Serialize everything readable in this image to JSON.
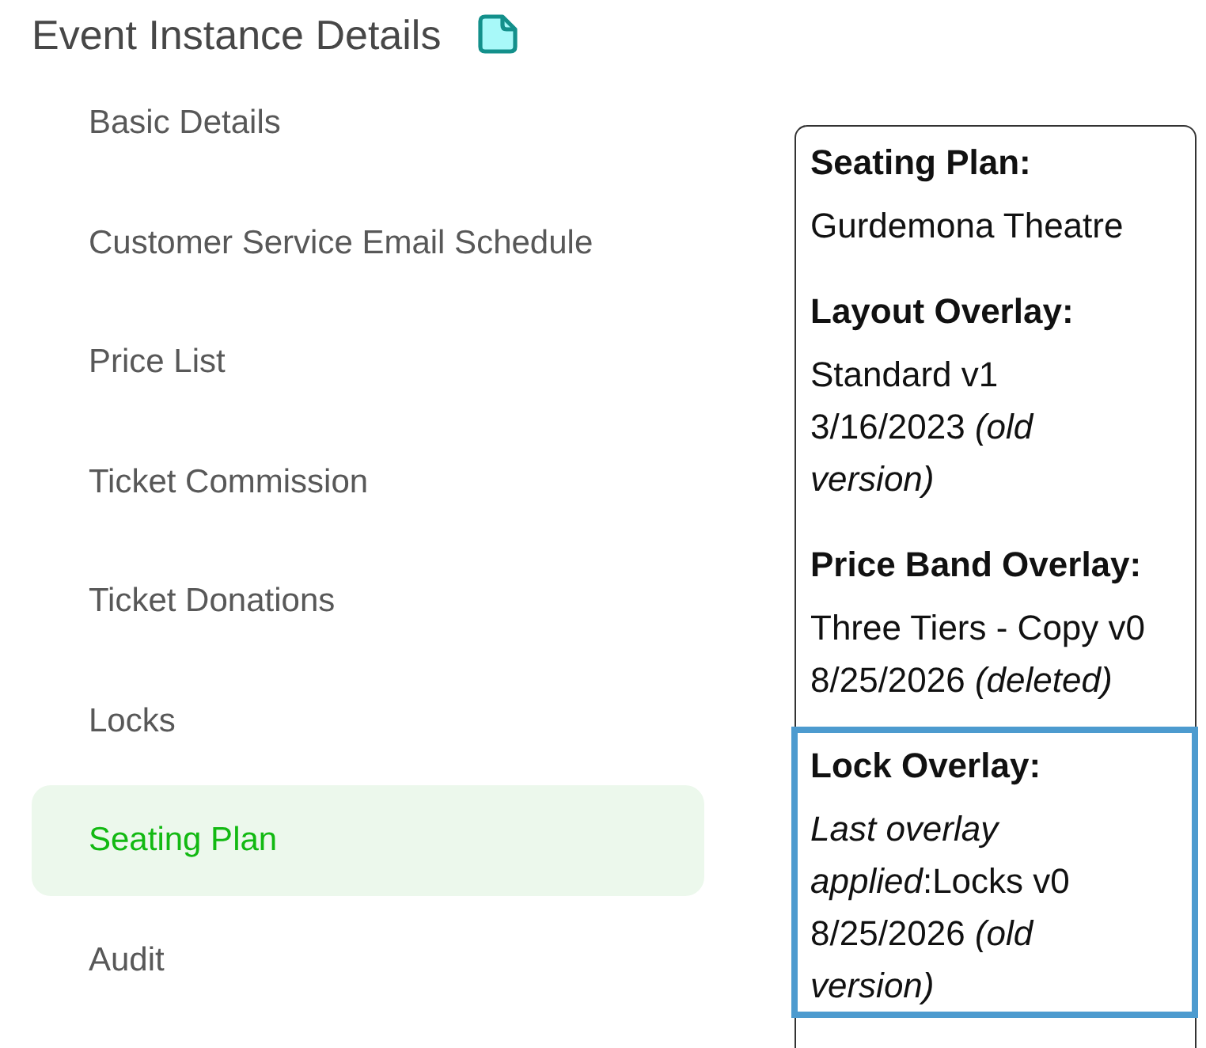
{
  "page": {
    "title": "Event Instance Details"
  },
  "nav": {
    "items": [
      {
        "label": "Basic Details",
        "selected": false
      },
      {
        "label": "Customer Service Email Schedule",
        "selected": false
      },
      {
        "label": "Price List",
        "selected": false
      },
      {
        "label": "Ticket Commission",
        "selected": false
      },
      {
        "label": "Ticket Donations",
        "selected": false
      },
      {
        "label": "Locks",
        "selected": false
      },
      {
        "label": "Seating Plan",
        "selected": true
      },
      {
        "label": "Audit",
        "selected": false
      }
    ]
  },
  "seating_panel": {
    "sections": [
      {
        "heading": "Seating Plan:",
        "value": "Gurdemona Theatre",
        "selected": false
      },
      {
        "heading": "Layout Overlay:",
        "value": "Standard v1 3/16/2023 *(old version)*",
        "selected": false
      },
      {
        "heading": "Price Band Overlay:",
        "value": "Three Tiers - Copy v0 8/25/2026 *(deleted)*",
        "selected": false
      },
      {
        "heading": "Lock Overlay:",
        "value": "*Last overlay applied*:Locks v0 8/25/2026 *(old version)*",
        "selected": true
      }
    ]
  }
}
